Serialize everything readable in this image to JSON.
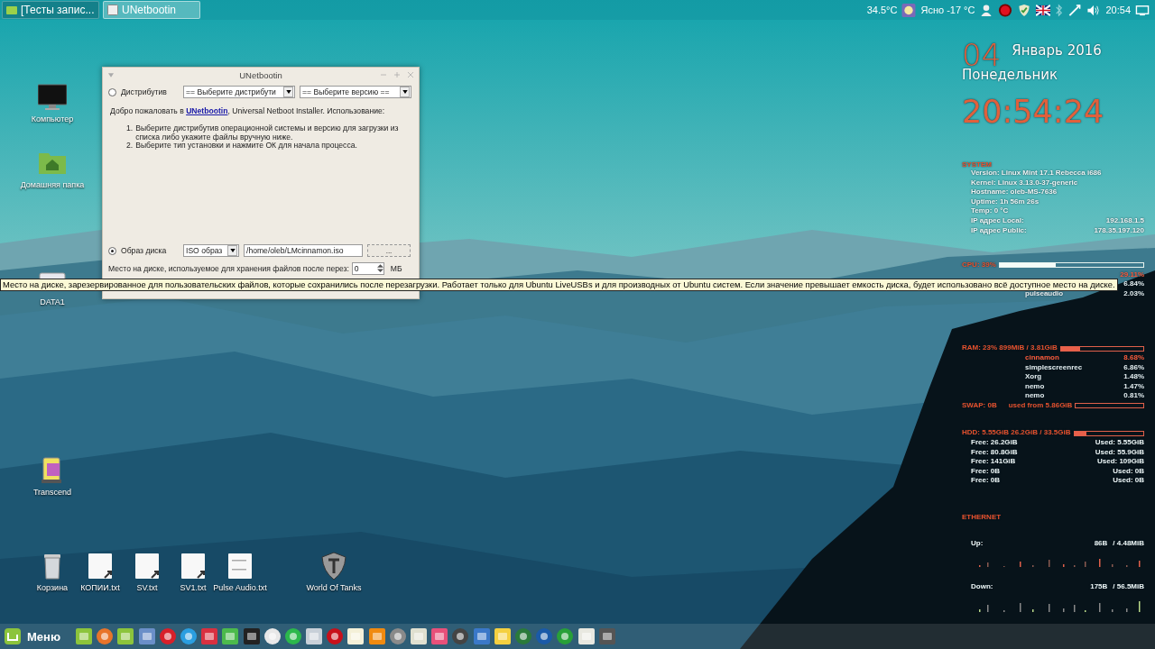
{
  "top_panel": {
    "windows": [
      {
        "title": "[Тесты запис...",
        "selected": false
      },
      {
        "title": "UNetbootin",
        "selected": true
      }
    ],
    "tray": {
      "temperature": "34.5°C",
      "weather": "Ясно -17 °C",
      "clock": "20:54"
    }
  },
  "desktop_icons": [
    {
      "label": "Компьютер",
      "kind": "monitor"
    },
    {
      "label": "Домашняя папка",
      "kind": "home-folder"
    },
    {
      "label": "DATA1",
      "kind": "drive"
    },
    {
      "label": "Transcend",
      "kind": "usb"
    },
    {
      "label": "Корзина",
      "kind": "trash"
    },
    {
      "label": "КОПИИ.txt",
      "kind": "text-link"
    },
    {
      "label": "SV.txt",
      "kind": "text-link"
    },
    {
      "label": "SV1.txt",
      "kind": "text-link"
    },
    {
      "label": "Pulse Audio.txt",
      "kind": "text-doc"
    },
    {
      "label": "World Of Tanks",
      "kind": "shield"
    }
  ],
  "window": {
    "title": "UNetbootin",
    "distro": {
      "label": "Дистрибутив",
      "selected": false,
      "distro_select": "== Выберите дистрибути",
      "version_select": "== Выберите версию =="
    },
    "intro": {
      "before": "Добро пожаловать в ",
      "link": "UNetbootin",
      "after": ", Universal Netboot Installer. Использование:"
    },
    "steps": [
      {
        "number": "1.",
        "text": "Выберите дистрибутив операционной системы и версию для загрузки из списка либо укажите файлы вручную ниже."
      },
      {
        "number": "2.",
        "text": "Выберите тип установки и нажмите ОК для начала процесса."
      }
    ],
    "disk_image": {
      "label": "Образ диска",
      "selected": true,
      "type_select": "ISO образ",
      "path": "/home/oleb/LMcinnamon.iso",
      "browse": "..."
    },
    "space": {
      "label": "Место на диске, используемое для хранения файлов после перез:",
      "value": "0",
      "unit": "МБ"
    }
  },
  "tooltip": "Место на диске, зарезервированное для пользовательских файлов, которые сохранились после перезагрузки. Работает только для Ubuntu LiveUSBs  и для производных от Ubuntu систем. Если значение превышает емкость диска, будет использовано всё доступное место на диске.",
  "conky": {
    "day": "04",
    "month_year": "Январь 2016",
    "weekday": "Понедельник",
    "time": "20:54:24",
    "system": {
      "heading": "SYSTEM",
      "lines": [
        {
          "label": "Version: Linux Mint 17.1 Rebecca i686"
        },
        {
          "label": "Kernel: Linux 3.13.0-37-generic"
        },
        {
          "label": "Hostname: oleb-MS-7636"
        },
        {
          "label": "Uptime: 1h 56m 26s"
        },
        {
          "label": "Temp: 0   °C"
        },
        {
          "label": "IP адрес Local:",
          "value": "192.168.1.5"
        },
        {
          "label": "IP адрес Public:",
          "value": "178.35.197.120"
        }
      ]
    },
    "cpu": {
      "heading": "CPU: 39%",
      "level": 0.39,
      "processes": [
        {
          "value": "29.11%",
          "highlight": true
        },
        {
          "value": "6.84%",
          "highlight": false
        },
        {
          "name": "pulseaudio",
          "value": "2.03%",
          "highlight": false
        }
      ]
    },
    "ram": {
      "heading": "RAM: 23% 899MiB  / 3.81GiB",
      "level": 0.23,
      "processes": [
        {
          "name": "cinnamon",
          "value": "8.68%",
          "highlight": true
        },
        {
          "name": "simplescreenrec",
          "value": "6.86%",
          "highlight": false
        },
        {
          "name": "Xorg",
          "value": "1.48%",
          "highlight": false
        },
        {
          "name": "nemo",
          "value": "1.47%",
          "highlight": false
        },
        {
          "name": "nemo",
          "value": "0.81%",
          "highlight": false
        }
      ]
    },
    "swap": {
      "heading": "SWAP: 0B",
      "detail": "used from 5.86GiB"
    },
    "hdd": {
      "heading": "HDD: 5.55GiB 26.2GiB / 33.5GiB",
      "level": 0.17,
      "drives": [
        {
          "free": "Free: 26.2GiB",
          "used": "Used: 5.55GiB"
        },
        {
          "free": "Free: 80.8GiB",
          "used": "Used: 55.9GiB"
        },
        {
          "free": "Free: 141GiB",
          "used": "Used: 109GiB"
        },
        {
          "free": "Free: 0B",
          "used": "Used: 0B"
        },
        {
          "free": "Free: 0B",
          "used": "Used: 0B"
        }
      ]
    },
    "ethernet": {
      "heading": "ETHERNET",
      "up": {
        "label": "Up:",
        "rate": "86B",
        "total": "/ 4.48MiB"
      },
      "down": {
        "label": "Down:",
        "rate": "175B",
        "total": "/ 56.5MiB"
      }
    }
  },
  "bottom_panel": {
    "menu": "Меню"
  }
}
